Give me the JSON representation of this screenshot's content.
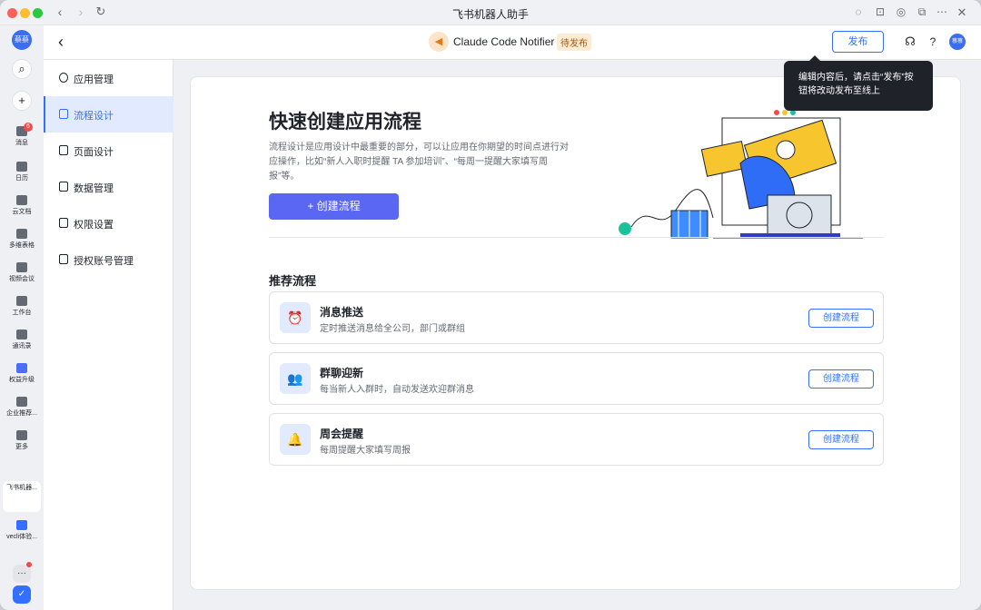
{
  "window": {
    "title": "飞书机器人助手"
  },
  "rail": {
    "avatar": "蔡蔡",
    "items": [
      {
        "label": "消息",
        "badge": "6"
      },
      {
        "label": "日历"
      },
      {
        "label": "云文档"
      },
      {
        "label": "多维表格"
      },
      {
        "label": "视频会议"
      },
      {
        "label": "工作台"
      },
      {
        "label": "通讯录"
      },
      {
        "label": "权益升级"
      },
      {
        "label": "企业推荐..."
      },
      {
        "label": "更多"
      }
    ],
    "apps": [
      {
        "label": "飞书机器..."
      },
      {
        "label": "vecli体验..."
      }
    ],
    "more_label": "···"
  },
  "header": {
    "app_name": "Claude Code Notifier",
    "status": "待发布",
    "publish_label": "发布",
    "avatar": "蔡蔡"
  },
  "tooltip": {
    "text": "编辑内容后，请点击“发布”按钮将改动发布至线上"
  },
  "sidenav": {
    "items": [
      {
        "label": "应用管理"
      },
      {
        "label": "流程设计"
      },
      {
        "label": "页面设计"
      },
      {
        "label": "数据管理"
      },
      {
        "label": "权限设置"
      },
      {
        "label": "授权账号管理"
      }
    ]
  },
  "hero": {
    "title": "快速创建应用流程",
    "description": "流程设计是应用设计中最重要的部分，可以让应用在你期望的时间点进行对应操作，比如“新人入职时提醒 TA 参加培训”、“每周一提醒大家填写周报”等。",
    "create_label": "+ 创建流程"
  },
  "recommended": {
    "title": "推荐流程",
    "items": [
      {
        "title": "消息推送",
        "desc": "定时推送消息给全公司，部门或群组",
        "button": "创建流程",
        "icon": "alarm-clock-icon"
      },
      {
        "title": "群聊迎新",
        "desc": "每当新人入群时，自动发送欢迎群消息",
        "button": "创建流程",
        "icon": "group-users-icon"
      },
      {
        "title": "周会提醒",
        "desc": "每周提醒大家填写周报",
        "button": "创建流程",
        "icon": "bell-icon"
      }
    ]
  }
}
